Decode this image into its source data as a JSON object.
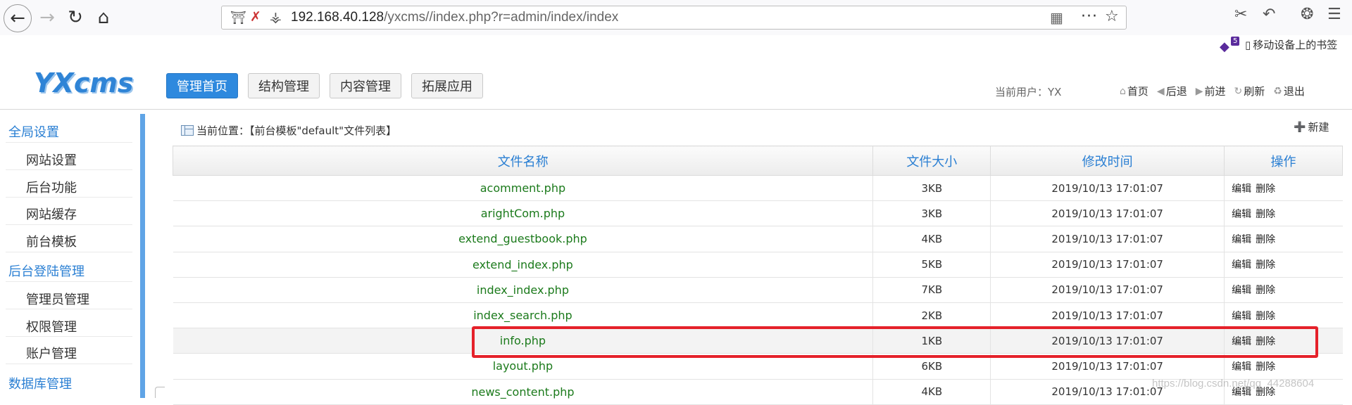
{
  "browser": {
    "url_host": "192.168.40.128",
    "url_path": "/yxcms//index.php?r=admin/index/index",
    "bookmark_badge": "5",
    "mobile_bookmarks": "移动设备上的书签"
  },
  "header": {
    "logo": "YXcms",
    "tabs": [
      {
        "label": "管理首页",
        "active": true
      },
      {
        "label": "结构管理",
        "active": false
      },
      {
        "label": "内容管理",
        "active": false
      },
      {
        "label": "拓展应用",
        "active": false
      }
    ],
    "current_user": "当前用户：YX",
    "quick_links": [
      "首页",
      "后退",
      "前进",
      "刷新",
      "退出"
    ]
  },
  "sidebar": {
    "groups": [
      {
        "title": "全局设置",
        "items": [
          "网站设置",
          "后台功能",
          "网站缓存",
          "前台模板"
        ]
      },
      {
        "title": "后台登陆管理",
        "items": [
          "管理员管理",
          "权限管理",
          "账户管理"
        ]
      },
      {
        "title": "数据库管理",
        "items": []
      }
    ]
  },
  "main": {
    "breadcrumb": "当前位置：【前台模板\"default\"文件列表】",
    "new_label": "新建",
    "columns": [
      "文件名称",
      "文件大小",
      "修改时间",
      "操作"
    ],
    "edit_label": "编辑",
    "delete_label": "删除",
    "rows": [
      {
        "name": "acomment.php",
        "size": "3KB",
        "time": "2019/10/13 17:01:07"
      },
      {
        "name": "arightCom.php",
        "size": "3KB",
        "time": "2019/10/13 17:01:07"
      },
      {
        "name": "extend_guestbook.php",
        "size": "4KB",
        "time": "2019/10/13 17:01:07"
      },
      {
        "name": "extend_index.php",
        "size": "5KB",
        "time": "2019/10/13 17:01:07"
      },
      {
        "name": "index_index.php",
        "size": "7KB",
        "time": "2019/10/13 17:01:07"
      },
      {
        "name": "index_search.php",
        "size": "2KB",
        "time": "2019/10/13 17:01:07"
      },
      {
        "name": "info.php",
        "size": "1KB",
        "time": "2019/10/13 17:01:07",
        "highlighted": true
      },
      {
        "name": "layout.php",
        "size": "6KB",
        "time": "2019/10/13 17:01:07"
      },
      {
        "name": "news_content.php",
        "size": "4KB",
        "time": "2019/10/13 17:01:07"
      }
    ]
  },
  "watermark": "https://blog.csdn.net/qq_44288604",
  "colors": {
    "accent": "#2e89de",
    "link_green": "#1b7a1b",
    "highlight_red": "#e5212a"
  }
}
